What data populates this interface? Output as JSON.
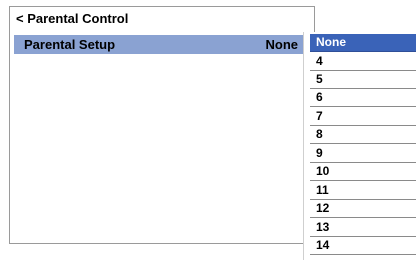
{
  "header": {
    "title": "< Parental Control"
  },
  "row": {
    "label": "Parental Setup",
    "value": "None"
  },
  "dropdown": {
    "selected_index": 0,
    "options": [
      "None",
      "4",
      "5",
      "6",
      "7",
      "8",
      "9",
      "10",
      "11",
      "12",
      "13",
      "14"
    ]
  },
  "colors": {
    "row_highlight": "#8aa2d2",
    "selected_option": "#3a63b8"
  }
}
